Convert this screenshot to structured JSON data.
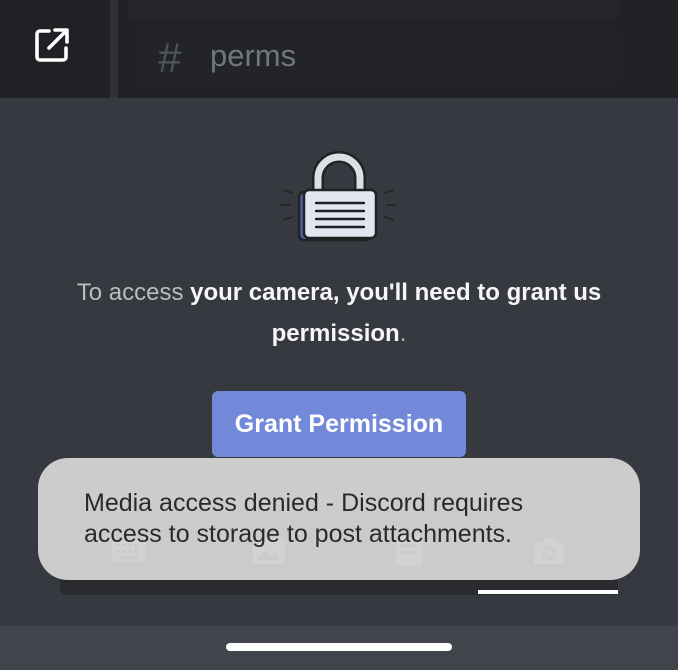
{
  "header": {
    "channel_hash": "#",
    "channel_name": "perms",
    "open_icon": "open-external-icon"
  },
  "main": {
    "lock_icon": "lock-icon",
    "text_part1": "To access ",
    "text_bold": "your camera, you'll need to grant us permission",
    "text_part2": ".",
    "grant_button": "Grant Permission"
  },
  "tray": {
    "icons": [
      "keyboard-icon",
      "image-icon",
      "file-icon",
      "camera-icon"
    ]
  },
  "toast": {
    "message": "Media access denied - Discord requires access to storage to post attachments."
  },
  "colors": {
    "background": "#36393f",
    "topbar": "#202225",
    "accent": "#7289da"
  }
}
